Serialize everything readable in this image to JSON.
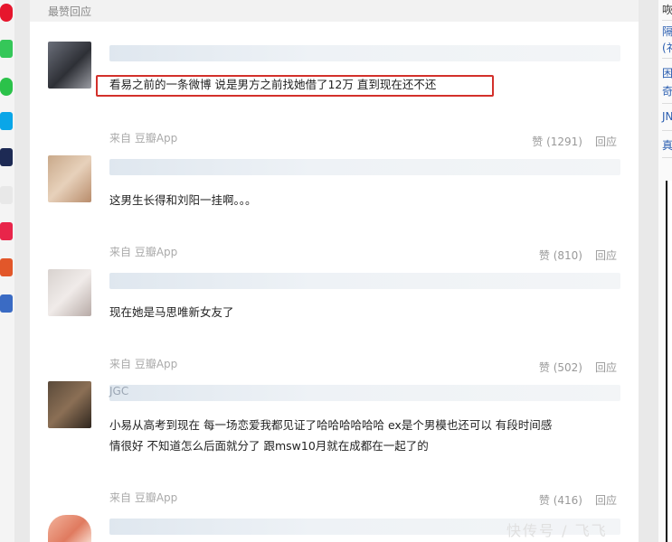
{
  "section": {
    "title": "最赞回应"
  },
  "comments": [
    {
      "text": "看易之前的一条微博 说是男方之前找她借了12万 直到现在还不还",
      "source": "来自 豆瓣App",
      "likes": "赞 (1291)",
      "reply": "回应",
      "highlighted": true
    },
    {
      "text": "这男生长得和刘阳一挂啊。。。",
      "source": "来自 豆瓣App",
      "likes": "赞 (810)",
      "reply": "回应"
    },
    {
      "text": "现在她是马思唯新女友了",
      "source": "来自 豆瓣App",
      "likes": "赞 (502)",
      "reply": "回应"
    },
    {
      "name_partial": "JGC",
      "text_line1": "小易从高考到现在 每一场恋爱我都见证了哈哈哈哈哈哈 ex是个男模也还可以 有段时间感",
      "text_line2": "情很好 不知道怎么后面就分了 跟msw10月就在成都在一起了的",
      "source": "来自 豆瓣App",
      "likes": "赞 (416)",
      "reply": "回应"
    }
  ],
  "right_panel": {
    "items": [
      "咴",
      "隔",
      "(礻",
      "困",
      "奇",
      "JN",
      "真"
    ]
  },
  "watermark": "快传号 / 飞飞",
  "colors": {
    "highlight": "#d3302b",
    "link": "#2a5db0"
  }
}
